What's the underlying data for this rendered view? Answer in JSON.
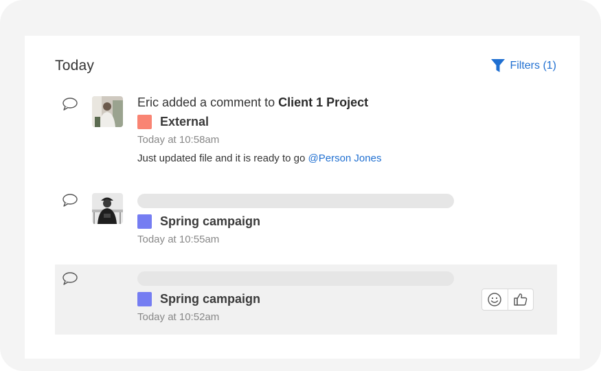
{
  "feed": {
    "heading": "Today",
    "filters_label": "Filters (1)",
    "filter_icon_color": "#1f6fd1"
  },
  "activities": [
    {
      "actor": "Eric",
      "action": " added a comment to ",
      "target": "Client 1 Project",
      "tag": {
        "name": "External",
        "color": "#f98473"
      },
      "time": "Today at 10:58am",
      "message": "Just updated file and it is ready to go ",
      "mention": "@Person Jones"
    },
    {
      "tag": {
        "name": "Spring campaign",
        "color": "#757df2"
      },
      "time": "Today at 10:55am"
    },
    {
      "tag": {
        "name": "Spring campaign",
        "color": "#757df2"
      },
      "time": "Today at 10:52am"
    }
  ],
  "icons": {
    "comment": "comment-icon",
    "filter": "filter-icon",
    "emoji": "smiley-icon",
    "like": "thumbs-up-icon"
  }
}
